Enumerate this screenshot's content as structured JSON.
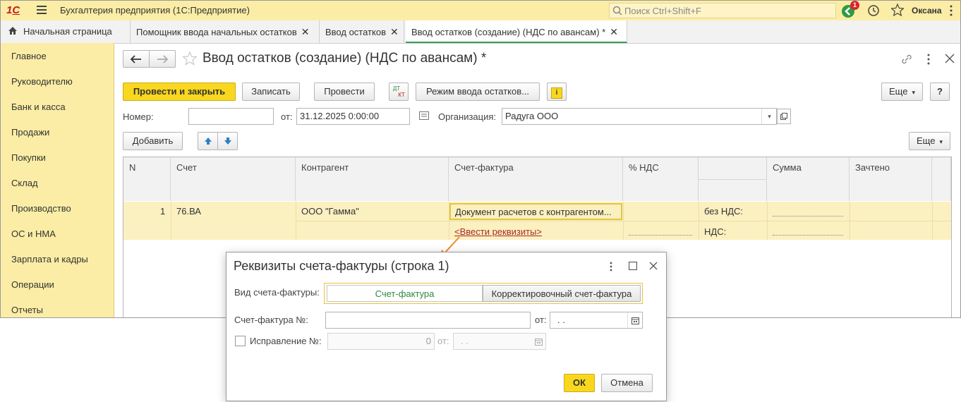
{
  "app": {
    "title": "Бухгалтерия предприятия (1С:Предприятие)",
    "search_placeholder": "Поиск Ctrl+Shift+F",
    "notification_count": "1",
    "user": "Оксана"
  },
  "tabs": [
    {
      "label": "Начальная страница"
    },
    {
      "label": "Помощник ввода начальных остатков"
    },
    {
      "label": "Ввод остатков"
    },
    {
      "label": "Ввод остатков (создание) (НДС по авансам) *"
    }
  ],
  "sidebar": {
    "items": [
      {
        "label": "Главное"
      },
      {
        "label": "Руководителю"
      },
      {
        "label": "Банк и касса"
      },
      {
        "label": "Продажи"
      },
      {
        "label": "Покупки"
      },
      {
        "label": "Склад"
      },
      {
        "label": "Производство"
      },
      {
        "label": "ОС и НМА"
      },
      {
        "label": "Зарплата и кадры"
      },
      {
        "label": "Операции"
      },
      {
        "label": "Отчеты"
      }
    ]
  },
  "form": {
    "title": "Ввод остатков (создание) (НДС по авансам) *",
    "post_close_label": "Провести и закрыть",
    "save_label": "Записать",
    "post_label": "Провести",
    "dt_kt_label_top": "ДТ",
    "dt_kt_label_bottom": "КТ",
    "mode_label": "Режим ввода остатков...",
    "more_label": "Еще",
    "help_label": "?",
    "number_label": "Номер:",
    "number_value": "",
    "date_label": "от:",
    "date_value": "31.12.2025  0:00:00",
    "org_label": "Организация:",
    "org_value": "Радуга ООО",
    "add_label": "Добавить",
    "more2_label": "Еще"
  },
  "table": {
    "columns": [
      "N",
      "Счет",
      "Контрагент",
      "Счет-фактура",
      "% НДС",
      "",
      "Сумма",
      "Зачтено"
    ],
    "rows": [
      {
        "n": "1",
        "account": "76.ВА",
        "counterparty": "ООО \"Гамма\"",
        "invoice": "Документ расчетов с контрагентом...",
        "invoice_link": "<Ввести реквизиты>",
        "vat_pct": "",
        "without_vat_label": "без НДС:",
        "vat_label": "НДС:",
        "sum": "",
        "credited": ""
      }
    ]
  },
  "dialog": {
    "title": "Реквизиты счета-фактуры (строка 1)",
    "kind_label": "Вид счета-фактуры:",
    "kind_option1": "Счет-фактура",
    "kind_option2": "Корректировочный счет-фактура",
    "invoice_no_label": "Счет-фактура №:",
    "invoice_no_value": "",
    "from_label": "от:",
    "date_value": " .  .",
    "correction_label": "Исправление №:",
    "correction_value": "0",
    "from2_label": "от:",
    "date2_value": " .  .",
    "ok_label": "ОК",
    "cancel_label": "Отмена"
  },
  "colors": {
    "accent_yellow": "#f9d71f",
    "panel_yellow": "#fbeda5",
    "link_red": "#a52a2a",
    "active_green": "#3a9b5a",
    "annotation_arrow": "#f08a24"
  }
}
